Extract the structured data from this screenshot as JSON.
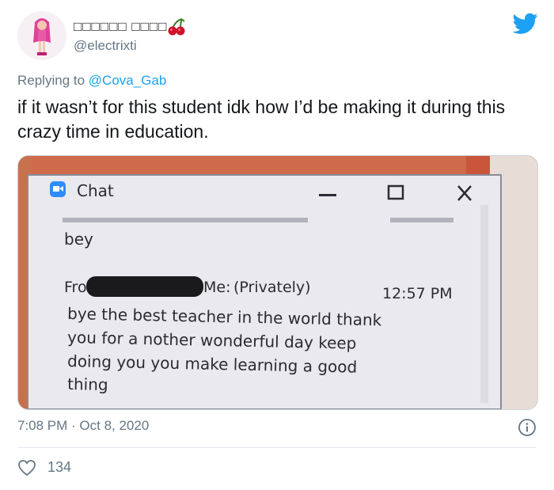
{
  "tweet": {
    "display_name": "□□□□□□ □□□□",
    "handle": "@electrixti",
    "replying_prefix": "Replying to ",
    "replying_to": "@Cova_Gab",
    "text": "if it wasn’t for this student idk how I’d be making it during this crazy time in education.",
    "timestamp": "7:08 PM · Oct 8, 2020",
    "likes": "134"
  },
  "photo": {
    "window_title": "Chat",
    "prev_line": "bey",
    "from_prefix": "Fro",
    "to_label": "Me:",
    "privately": "(Privately)",
    "time": "12:57 PM",
    "message_lines": [
      "bye the best teacher in the world thank",
      "you for a nother wonderful day keep",
      "doing you you make learning a good",
      "thing"
    ]
  },
  "colors": {
    "accent": "#1da1f2",
    "muted": "#657786",
    "text": "#14171a"
  },
  "icons": [
    "twitter-bird-icon",
    "cherry-icon",
    "info-icon",
    "heart-icon",
    "zoom-camera-icon",
    "minimize-icon",
    "maximize-icon",
    "close-icon"
  ]
}
